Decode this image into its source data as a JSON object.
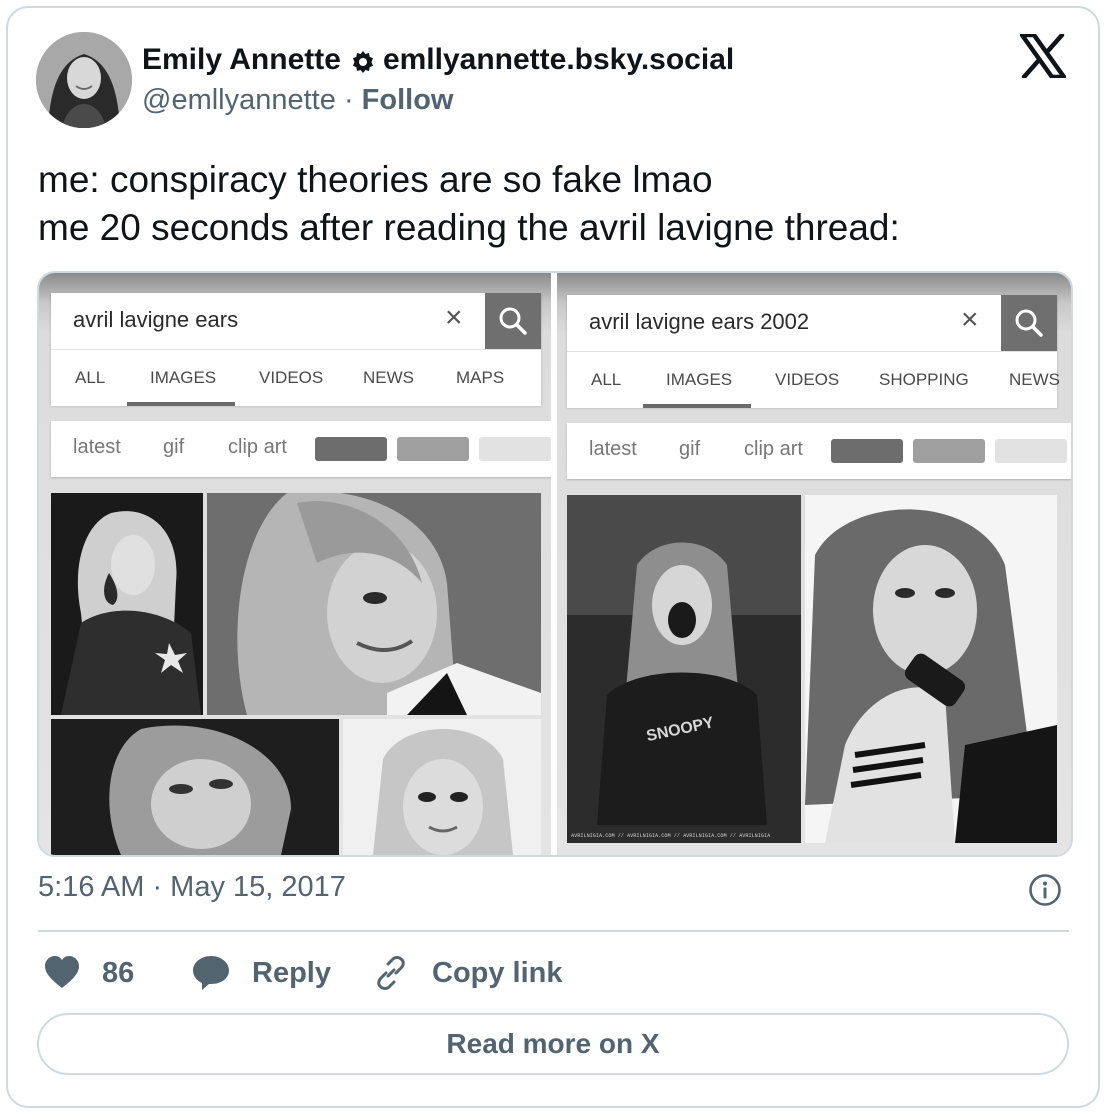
{
  "author": {
    "name": "Emily Annette",
    "bsky_handle": "emllyannette.bsky.social",
    "handle": "@emllyannette",
    "separator": "·",
    "follow_label": "Follow"
  },
  "tweet": {
    "lines": [
      "me: conspiracy theories are so fake lmao",
      "me 20 seconds after reading the avril lavigne thread:"
    ]
  },
  "media": {
    "left": {
      "query": "avril lavigne ears",
      "tabs": [
        "ALL",
        "IMAGES",
        "VIDEOS",
        "NEWS",
        "MAPS"
      ],
      "active_tab": "IMAGES",
      "chips": [
        "latest",
        "gif",
        "clip art"
      ]
    },
    "right": {
      "query": "avril lavigne ears 2002",
      "tabs": [
        "ALL",
        "IMAGES",
        "VIDEOS",
        "SHOPPING",
        "NEWS"
      ],
      "active_tab": "IMAGES",
      "chips": [
        "latest",
        "gif",
        "clip art"
      ],
      "shirt_text": "SNOOPY",
      "watermark": "AVRILNIGIA.COM // AVRILNIGIA.COM // AVRILNIGIA.COM // AVRILNIGIA"
    }
  },
  "footer": {
    "timestamp": "5:16 AM · May 15, 2017",
    "like_count": "86",
    "reply_label": "Reply",
    "copy_link_label": "Copy link",
    "read_more_label": "Read more on X"
  },
  "icons": {
    "x_logo": "x-logo-icon",
    "verified": "bluesky-badge-icon",
    "info": "info-icon",
    "heart": "heart-icon",
    "reply": "speech-bubble-icon",
    "link": "link-icon",
    "search": "search-icon",
    "clear": "close-icon"
  },
  "colors": {
    "text": "#0f1419",
    "muted": "#536471",
    "border": "#cfd9de"
  }
}
